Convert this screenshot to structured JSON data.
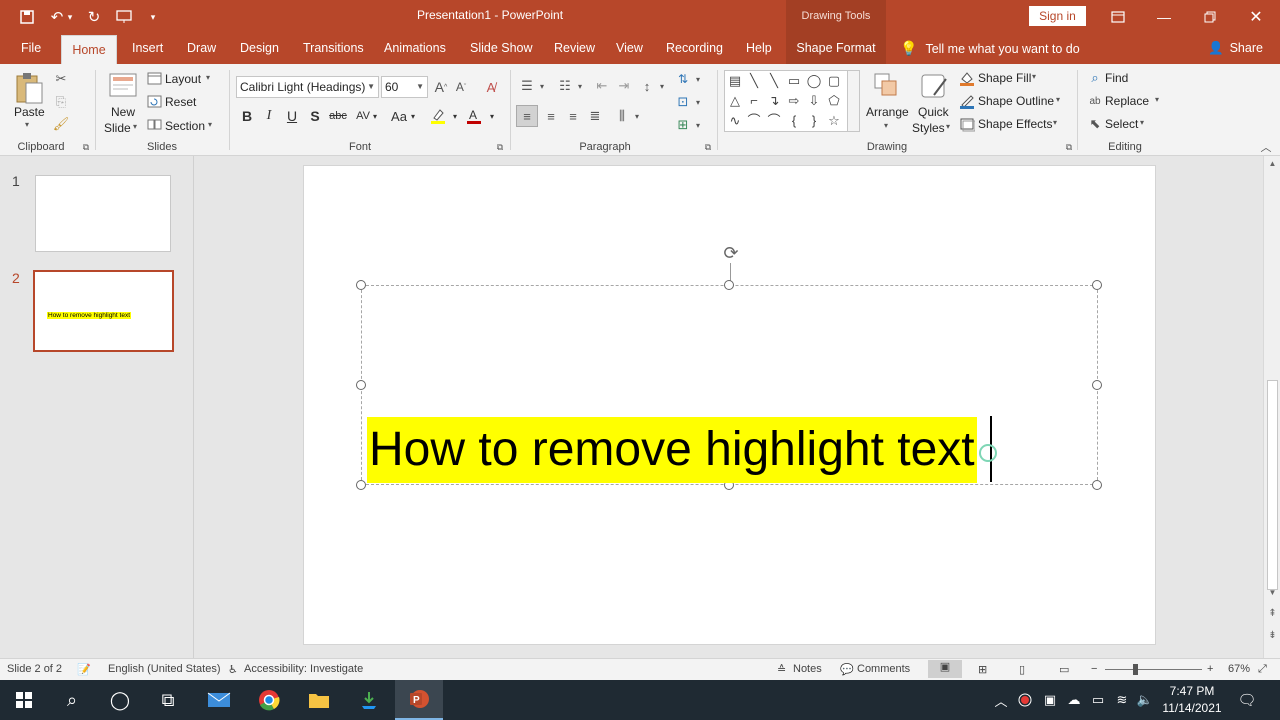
{
  "window": {
    "title": "Presentation1  -  PowerPoint",
    "context_tab_group": "Drawing Tools",
    "sign_in": "Sign in"
  },
  "tabs": [
    "File",
    "Home",
    "Insert",
    "Draw",
    "Design",
    "Transitions",
    "Animations",
    "Slide Show",
    "Review",
    "View",
    "Recording",
    "Help",
    "Shape Format"
  ],
  "active_tab": "Home",
  "tell_me": "Tell me what you want to do",
  "share": "Share",
  "ribbon": {
    "clipboard": {
      "paste": "Paste",
      "label": "Clipboard"
    },
    "slides": {
      "new_slide_1": "New",
      "new_slide_2": "Slide",
      "layout": "Layout",
      "reset": "Reset",
      "section": "Section",
      "label": "Slides"
    },
    "font": {
      "font_name": "Calibri Light (Headings)",
      "font_size": "60",
      "label": "Font"
    },
    "paragraph": {
      "label": "Paragraph"
    },
    "drawing": {
      "arrange": "Arrange",
      "quick_styles_1": "Quick",
      "quick_styles_2": "Styles",
      "shape_fill": "Shape Fill",
      "shape_outline": "Shape Outline",
      "shape_effects": "Shape Effects",
      "label": "Drawing"
    },
    "editing": {
      "find": "Find",
      "replace": "Replace",
      "select": "Select",
      "label": "Editing"
    }
  },
  "thumbnails": [
    {
      "num": "1",
      "text": ""
    },
    {
      "num": "2",
      "text": "How to remove highlight text"
    }
  ],
  "slide": {
    "text": "How to remove highlight text",
    "highlight_color": "#ffff00"
  },
  "status": {
    "slide_of": "Slide 2 of 2",
    "language": "English (United States)",
    "accessibility": "Accessibility: Investigate",
    "notes": "Notes",
    "comments": "Comments",
    "zoom": "67%"
  },
  "taskbar": {
    "time": "7:47 PM",
    "date": "11/14/2021"
  },
  "colors": {
    "accent": "#b7472a",
    "highlight": "#ffff00"
  }
}
